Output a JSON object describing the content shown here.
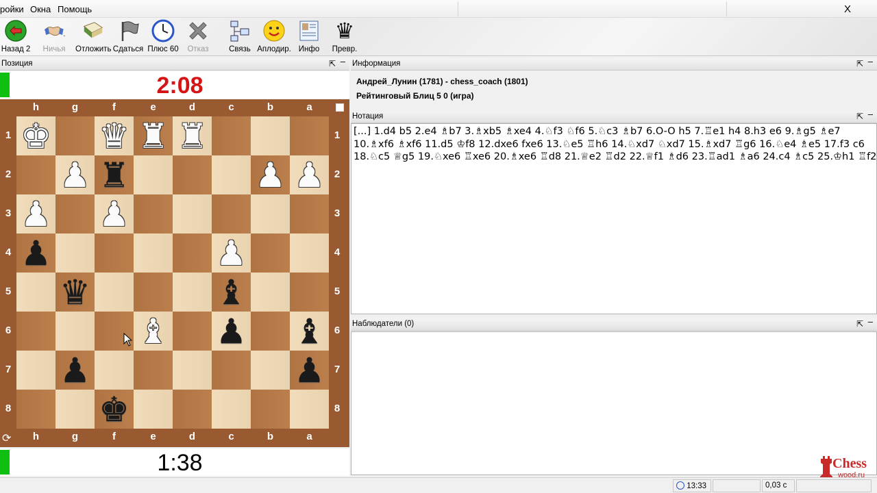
{
  "menu": {
    "items": [
      "ройки",
      "Окна",
      "Помощь"
    ],
    "close": "X"
  },
  "toolbar": [
    {
      "label": "Назад 2",
      "icon": "back-arrow-icon",
      "disabled": false
    },
    {
      "label": "Ничья",
      "icon": "handshake-icon",
      "disabled": true
    },
    {
      "label": "Отложить",
      "icon": "books-icon",
      "disabled": false
    },
    {
      "label": "Сдаться",
      "icon": "flag-icon",
      "disabled": false
    },
    {
      "label": "Плюс 60",
      "icon": "clock-icon",
      "disabled": false
    },
    {
      "label": "Отказ",
      "icon": "cross-icon",
      "disabled": true
    },
    {
      "label": "Связь",
      "icon": "network-icon",
      "disabled": false
    },
    {
      "label": "Аплодир.",
      "icon": "smiley-icon",
      "disabled": false
    },
    {
      "label": "Инфо",
      "icon": "info-card-icon",
      "disabled": false
    },
    {
      "label": "Превр.",
      "icon": "queen-icon",
      "disabled": false
    }
  ],
  "position_panel": {
    "title": "Позиция"
  },
  "clocks": {
    "top": "2:08",
    "bottom": "1:38"
  },
  "board": {
    "files": [
      "h",
      "g",
      "f",
      "e",
      "d",
      "c",
      "b",
      "a"
    ],
    "ranks": [
      "1",
      "2",
      "3",
      "4",
      "5",
      "6",
      "7",
      "8"
    ],
    "pieces": [
      {
        "sq": "h1",
        "type": "king",
        "color": "w",
        "glyph": "♚"
      },
      {
        "sq": "f1",
        "type": "queen",
        "color": "w",
        "glyph": "♛"
      },
      {
        "sq": "e1",
        "type": "rook",
        "color": "w",
        "glyph": "♜"
      },
      {
        "sq": "d1",
        "type": "rook",
        "color": "w",
        "glyph": "♜"
      },
      {
        "sq": "g2",
        "type": "pawn",
        "color": "w",
        "glyph": "♟"
      },
      {
        "sq": "f2",
        "type": "rook",
        "color": "b",
        "glyph": "♜"
      },
      {
        "sq": "b2",
        "type": "pawn",
        "color": "w",
        "glyph": "♟"
      },
      {
        "sq": "a2",
        "type": "pawn",
        "color": "w",
        "glyph": "♟"
      },
      {
        "sq": "h3",
        "type": "pawn",
        "color": "w",
        "glyph": "♟"
      },
      {
        "sq": "f3",
        "type": "pawn",
        "color": "w",
        "glyph": "♟"
      },
      {
        "sq": "h4",
        "type": "pawn",
        "color": "b",
        "glyph": "♟"
      },
      {
        "sq": "c4",
        "type": "pawn",
        "color": "w",
        "glyph": "♟"
      },
      {
        "sq": "g5",
        "type": "queen",
        "color": "b",
        "glyph": "♛"
      },
      {
        "sq": "c5",
        "type": "bishop",
        "color": "b",
        "glyph": "♝"
      },
      {
        "sq": "e6",
        "type": "bishop",
        "color": "w",
        "glyph": "♝"
      },
      {
        "sq": "c6",
        "type": "pawn",
        "color": "b",
        "glyph": "♟"
      },
      {
        "sq": "a6",
        "type": "bishop",
        "color": "b",
        "glyph": "♝"
      },
      {
        "sq": "g7",
        "type": "pawn",
        "color": "b",
        "glyph": "♟"
      },
      {
        "sq": "a7",
        "type": "pawn",
        "color": "b",
        "glyph": "♟"
      },
      {
        "sq": "f8",
        "type": "king",
        "color": "b",
        "glyph": "♚"
      }
    ]
  },
  "info_panel": {
    "title": "Информация",
    "line1": "Андрей_Лунин (1781) - chess_coach (1801)",
    "line2": "Рейтинговый Блиц 5 0  (игра)"
  },
  "notation_panel": {
    "title": "Нотация",
    "text": "[...] 1.d4 b5 2.e4 ♗b7 3.♗xb5 ♗xe4 4.♘f3 ♘f6 5.♘c3 ♗b7 6.O-O h5 7.♖e1 h4 8.h3 e6 9.♗g5 ♗e7 10.♗xf6 ♗xf6 11.d5 ♔f8 12.dxe6 fxe6 13.♘e5 ♖h6 14.♘xd7 ♘xd7 15.♗xd7 ♖g6 16.♘e4 ♗e5 17.f3 c6 18.♘c5 ♕g5 19.♘xe6 ♖xe6 20.♗xe6 ♖d8 21.♕e2 ♖d2 22.♕f1 ♗d6 23.♖ad1 ♗a6 24.c4 ♗c5 25.♔h1 ♖f2"
  },
  "observers_panel": {
    "title": "Наблюдатели (0)"
  },
  "statusbar": {
    "time": "13:33",
    "latency": "0,03 с"
  },
  "logo": {
    "word": "Chess",
    "sub": "wood.ru"
  },
  "colors": {
    "clock_red": "#d41515",
    "clock_bar": "#10c010",
    "board_light": "#f0d9b5",
    "board_dark": "#b87a45",
    "frame": "#9a5a31"
  }
}
